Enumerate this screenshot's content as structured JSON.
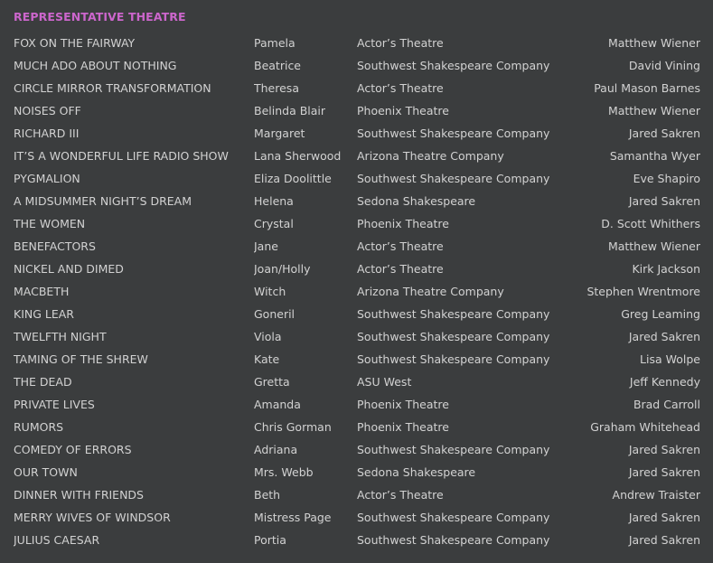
{
  "section": {
    "title": "REPRESENTATIVE THEATRE"
  },
  "credits": [
    {
      "show": "FOX ON THE FAIRWAY",
      "role": "Pamela",
      "company": "Actor’s Theatre",
      "director": "Matthew Wiener"
    },
    {
      "show": "MUCH ADO ABOUT NOTHING",
      "role": "Beatrice",
      "company": "Southwest Shakespeare Company",
      "director": "David Vining"
    },
    {
      "show": "CIRCLE MIRROR TRANSFORMATION",
      "role": "Theresa",
      "company": "Actor’s Theatre",
      "director": "Paul Mason Barnes"
    },
    {
      "show": "NOISES OFF",
      "role": "Belinda Blair",
      "company": "Phoenix Theatre",
      "director": "Matthew Wiener"
    },
    {
      "show": "RICHARD III",
      "role": "Margaret",
      "company": "Southwest Shakespeare Company",
      "director": "Jared Sakren"
    },
    {
      "show": "IT’S A WONDERFUL LIFE RADIO SHOW",
      "role": "Lana Sherwood",
      "company": "Arizona Theatre Company",
      "director": "Samantha Wyer"
    },
    {
      "show": "PYGMALION",
      "role": "Eliza Doolittle",
      "company": "Southwest Shakespeare Company",
      "director": "Eve Shapiro"
    },
    {
      "show": "A MIDSUMMER NIGHT’S DREAM",
      "role": "Helena",
      "company": "Sedona Shakespeare",
      "director": "Jared Sakren"
    },
    {
      "show": "THE WOMEN",
      "role": "Crystal",
      "company": "Phoenix Theatre",
      "director": "D. Scott Whithers"
    },
    {
      "show": "BENEFACTORS",
      "role": "Jane",
      "company": "Actor’s Theatre",
      "director": "Matthew Wiener"
    },
    {
      "show": "NICKEL AND DIMED",
      "role": "Joan/Holly",
      "company": "Actor’s Theatre",
      "director": "Kirk Jackson"
    },
    {
      "show": "MACBETH",
      "role": "Witch",
      "company": "Arizona Theatre Company",
      "director": "Stephen Wrentmore"
    },
    {
      "show": "KING LEAR",
      "role": "Goneril",
      "company": "Southwest Shakespeare Company",
      "director": "Greg Leaming"
    },
    {
      "show": "TWELFTH NIGHT",
      "role": "Viola",
      "company": "Southwest Shakespeare Company",
      "director": "Jared Sakren"
    },
    {
      "show": "TAMING OF THE SHREW",
      "role": "Kate",
      "company": "Southwest Shakespeare Company",
      "director": "Lisa Wolpe"
    },
    {
      "show": "THE DEAD",
      "role": "Gretta",
      "company": "ASU West",
      "director": "Jeff Kennedy"
    },
    {
      "show": "PRIVATE LIVES",
      "role": "Amanda",
      "company": "Phoenix Theatre",
      "director": "Brad Carroll"
    },
    {
      "show": "RUMORS",
      "role": "Chris Gorman",
      "company": "Phoenix Theatre",
      "director": "Graham Whitehead"
    },
    {
      "show": "COMEDY OF ERRORS",
      "role": "Adriana",
      "company": "Southwest Shakespeare Company",
      "director": "Jared Sakren"
    },
    {
      "show": "OUR TOWN",
      "role": "Mrs. Webb",
      "company": "Sedona Shakespeare",
      "director": "Jared Sakren"
    },
    {
      "show": "DINNER WITH FRIENDS",
      "role": "Beth",
      "company": "Actor’s Theatre",
      "director": "Andrew Traister"
    },
    {
      "show": "MERRY WIVES OF WINDSOR",
      "role": "Mistress Page",
      "company": "Southwest Shakespeare Company",
      "director": "Jared Sakren"
    },
    {
      "show": "JULIUS CAESAR",
      "role": "Portia",
      "company": "Southwest Shakespeare Company",
      "director": "Jared Sakren"
    }
  ]
}
